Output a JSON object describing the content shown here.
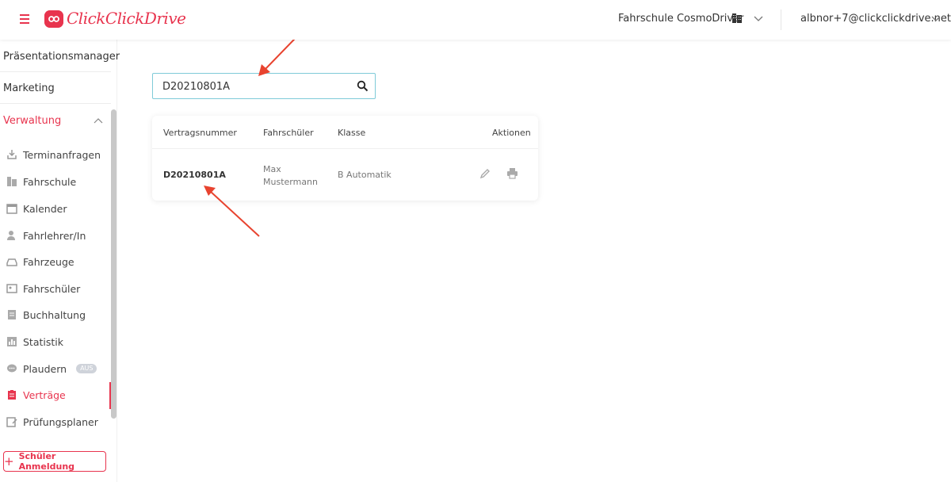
{
  "header": {
    "logo_text": "ClickClickDrive",
    "school_name": "Fahrschule CosmoDriver",
    "user_email": "albnor+7@clickclickdrive.net"
  },
  "sidebar": {
    "top_items": [
      "Präsentationsmanager",
      "Marketing"
    ],
    "section_label": "Verwaltung",
    "items": [
      {
        "label": "Terminanfragen",
        "icon": "inbox-download-icon"
      },
      {
        "label": "Fahrschule",
        "icon": "building-icon"
      },
      {
        "label": "Kalender",
        "icon": "calendar-icon"
      },
      {
        "label": "Fahrlehrer/In",
        "icon": "instructor-icon"
      },
      {
        "label": "Fahrzeuge",
        "icon": "car-icon"
      },
      {
        "label": "Fahrschüler",
        "icon": "student-card-icon"
      },
      {
        "label": "Buchhaltung",
        "icon": "ledger-icon"
      },
      {
        "label": "Statistik",
        "icon": "bar-chart-icon"
      },
      {
        "label": "Plaudern",
        "icon": "chat-icon",
        "badge": "AUS"
      },
      {
        "label": "Verträge",
        "icon": "clipboard-icon",
        "active": true
      },
      {
        "label": "Prüfungsplaner",
        "icon": "exam-planner-icon"
      }
    ],
    "register_button": "Schüler Anmeldung"
  },
  "search": {
    "value": "D20210801A"
  },
  "table": {
    "headers": [
      "Vertragsnummer",
      "Fahrschüler",
      "Klasse",
      "Aktionen"
    ],
    "rows": [
      {
        "contract_number": "D20210801A",
        "student_line1": "Max",
        "student_line2": "Mustermann",
        "class": "B Automatik"
      }
    ]
  },
  "colors": {
    "accent": "#e8344e",
    "search_border": "#7fcbd8",
    "annotation_arrow": "#e8432f"
  }
}
